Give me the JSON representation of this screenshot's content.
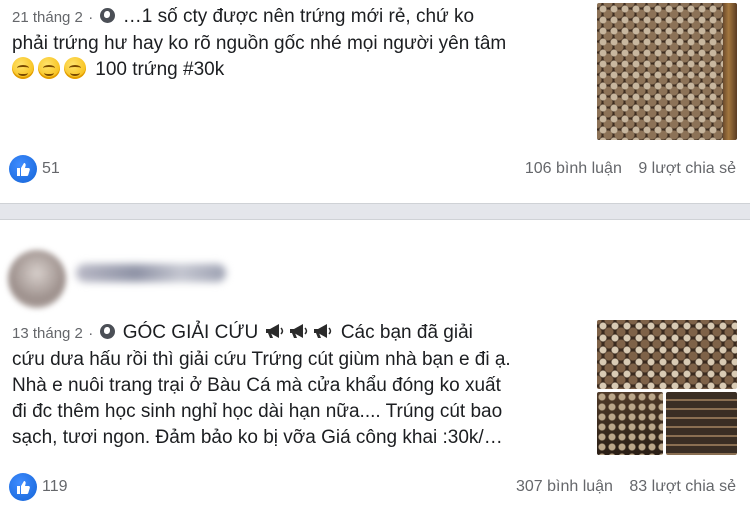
{
  "post1": {
    "date": "21 tháng 2",
    "sep": "·",
    "text_line1": "…1 số cty được nên trứng mới rẻ, chứ ko",
    "text_line2": "phải trứng hư hay ko rõ nguồn gốc nhé mọi người yên tâm",
    "text_line3": "100 trứng #30k",
    "likes": "51",
    "comments": "106 bình luận",
    "shares": "9 lượt chia sẻ"
  },
  "post2": {
    "date": "13 tháng 2",
    "sep": "·",
    "title": "GÓC GIẢI CỨU",
    "text_first": "Các bạn đã giải",
    "text_line2": "cứu dưa hấu rồi thì giải cứu Trứng cút giùm nhà bạn e đi ạ.",
    "text_line3": "Nhà e nuôi trang trại ở Bàu Cá mà cửa khẩu đóng ko xuất",
    "text_line4": "đi đc thêm học sinh nghỉ học dài hạn nữa.... Trúng cút bao",
    "text_line5": "sạch, tươi ngon. Đảm bảo ko bị vỡa Giá công khai :30k/…",
    "likes": "119",
    "comments": "307 bình luận",
    "shares": "83 lượt chia sẻ"
  },
  "icons": {
    "globe": "globe-icon",
    "like": "like-thumb-icon",
    "emoji": "smiling-face-icon",
    "megaphone": "megaphone-icon"
  },
  "colors": {
    "like_blue": "#1877f2",
    "meta_gray": "#65676b",
    "feed_bg": "#e4e6eb"
  }
}
